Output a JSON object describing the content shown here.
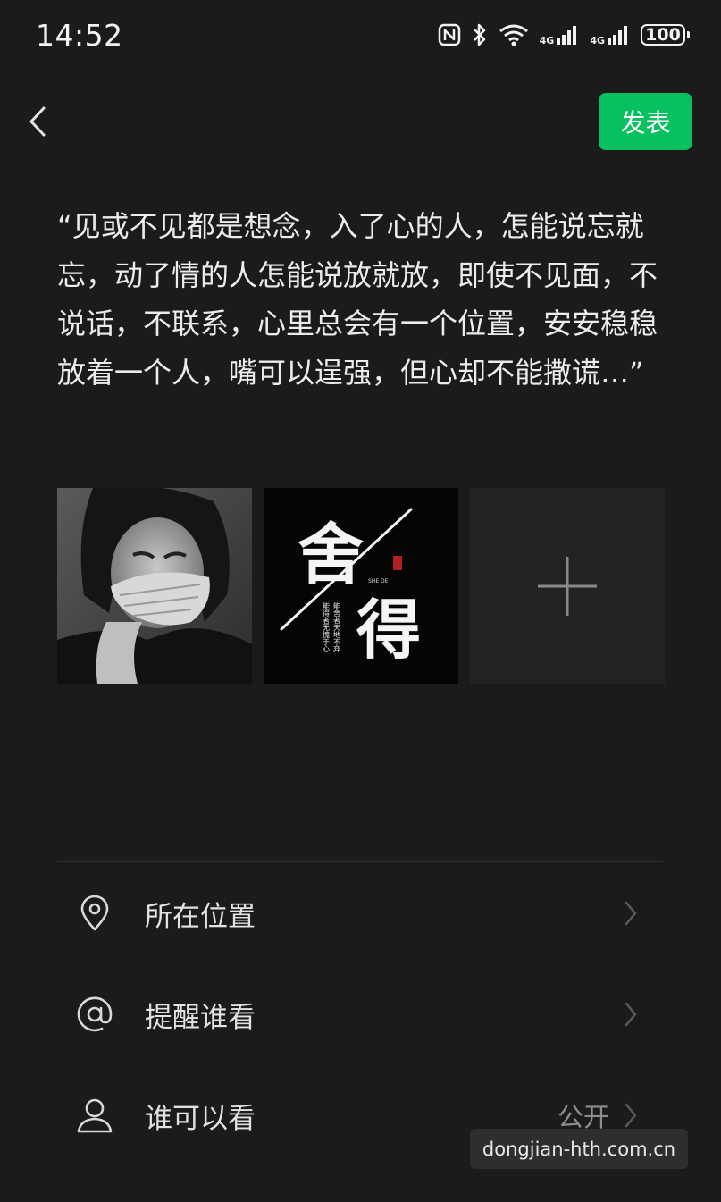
{
  "status_bar": {
    "time": "14:52",
    "network_1": "4G",
    "network_2": "4G",
    "battery": "100",
    "icons": [
      "nfc-icon",
      "bluetooth-icon",
      "wifi-icon",
      "signal-icon",
      "signal-icon",
      "battery-icon"
    ]
  },
  "header": {
    "back_icon": "chevron-left-icon",
    "publish_label": "发表",
    "publish_color": "#07c160"
  },
  "post": {
    "text": "“见或不见都是想念，入了心的人，怎能说忘就忘，动了情的人怎能说放就放，即使不见面，不说话，不联系，心里总会有一个位置，安安稳稳放着一个人，嘴可以逞强，但心却不能撒谎…”"
  },
  "images": {
    "photo_1": "black-and-white portrait, person covering mouth with hand",
    "photo_2": {
      "main_characters": "舍得",
      "subtitle": "SHE DE",
      "poem": [
        "能舍者天地不弃",
        "能得者无愧于心"
      ]
    },
    "add_icon": "plus-icon"
  },
  "options": [
    {
      "icon": "location-pin-icon",
      "label": "所在位置",
      "value": ""
    },
    {
      "icon": "at-sign-icon",
      "label": "提醒谁看",
      "value": ""
    },
    {
      "icon": "person-icon",
      "label": "谁可以看",
      "value": "公开"
    }
  ],
  "watermark": "dongjian-hth.com.cn"
}
